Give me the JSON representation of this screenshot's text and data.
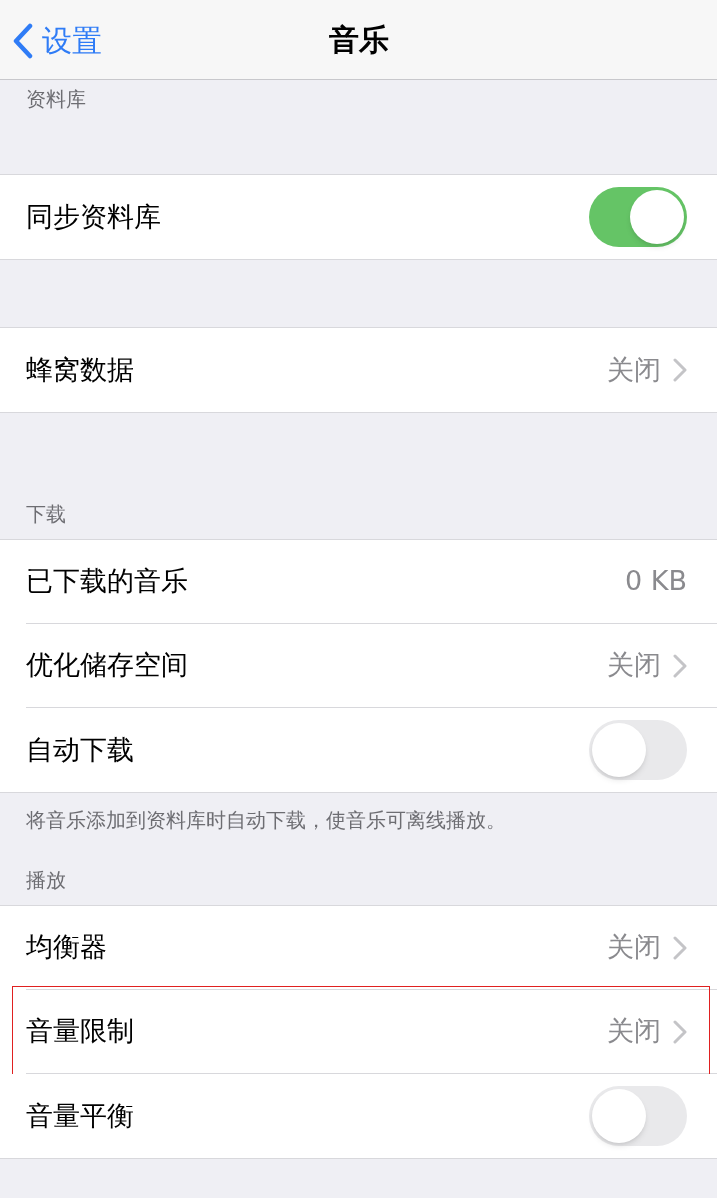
{
  "nav": {
    "back": "设置",
    "title": "音乐"
  },
  "sections": [
    {
      "header": "资料库"
    },
    {
      "rows": [
        {
          "kind": "toggle",
          "label": "同步资料库",
          "on": true,
          "highlighted": false
        }
      ]
    },
    {
      "rows": [
        {
          "kind": "link",
          "label": "蜂窝数据",
          "value": "关闭",
          "highlighted": false
        }
      ]
    },
    {
      "header": "下载",
      "rows": [
        {
          "kind": "value",
          "label": "已下载的音乐",
          "value": "0 KB",
          "highlighted": false
        },
        {
          "kind": "link",
          "label": "优化储存空间",
          "value": "关闭",
          "highlighted": false
        },
        {
          "kind": "toggle",
          "label": "自动下载",
          "on": false,
          "highlighted": false
        }
      ],
      "footer": "将音乐添加到资料库时自动下载，使音乐可离线播放。"
    },
    {
      "header": "播放",
      "rows": [
        {
          "kind": "link",
          "label": "均衡器",
          "value": "关闭",
          "highlighted": false
        },
        {
          "kind": "link",
          "label": "音量限制",
          "value": "关闭",
          "highlighted": true
        },
        {
          "kind": "toggle",
          "label": "音量平衡",
          "on": false,
          "highlighted": false
        }
      ]
    }
  ]
}
